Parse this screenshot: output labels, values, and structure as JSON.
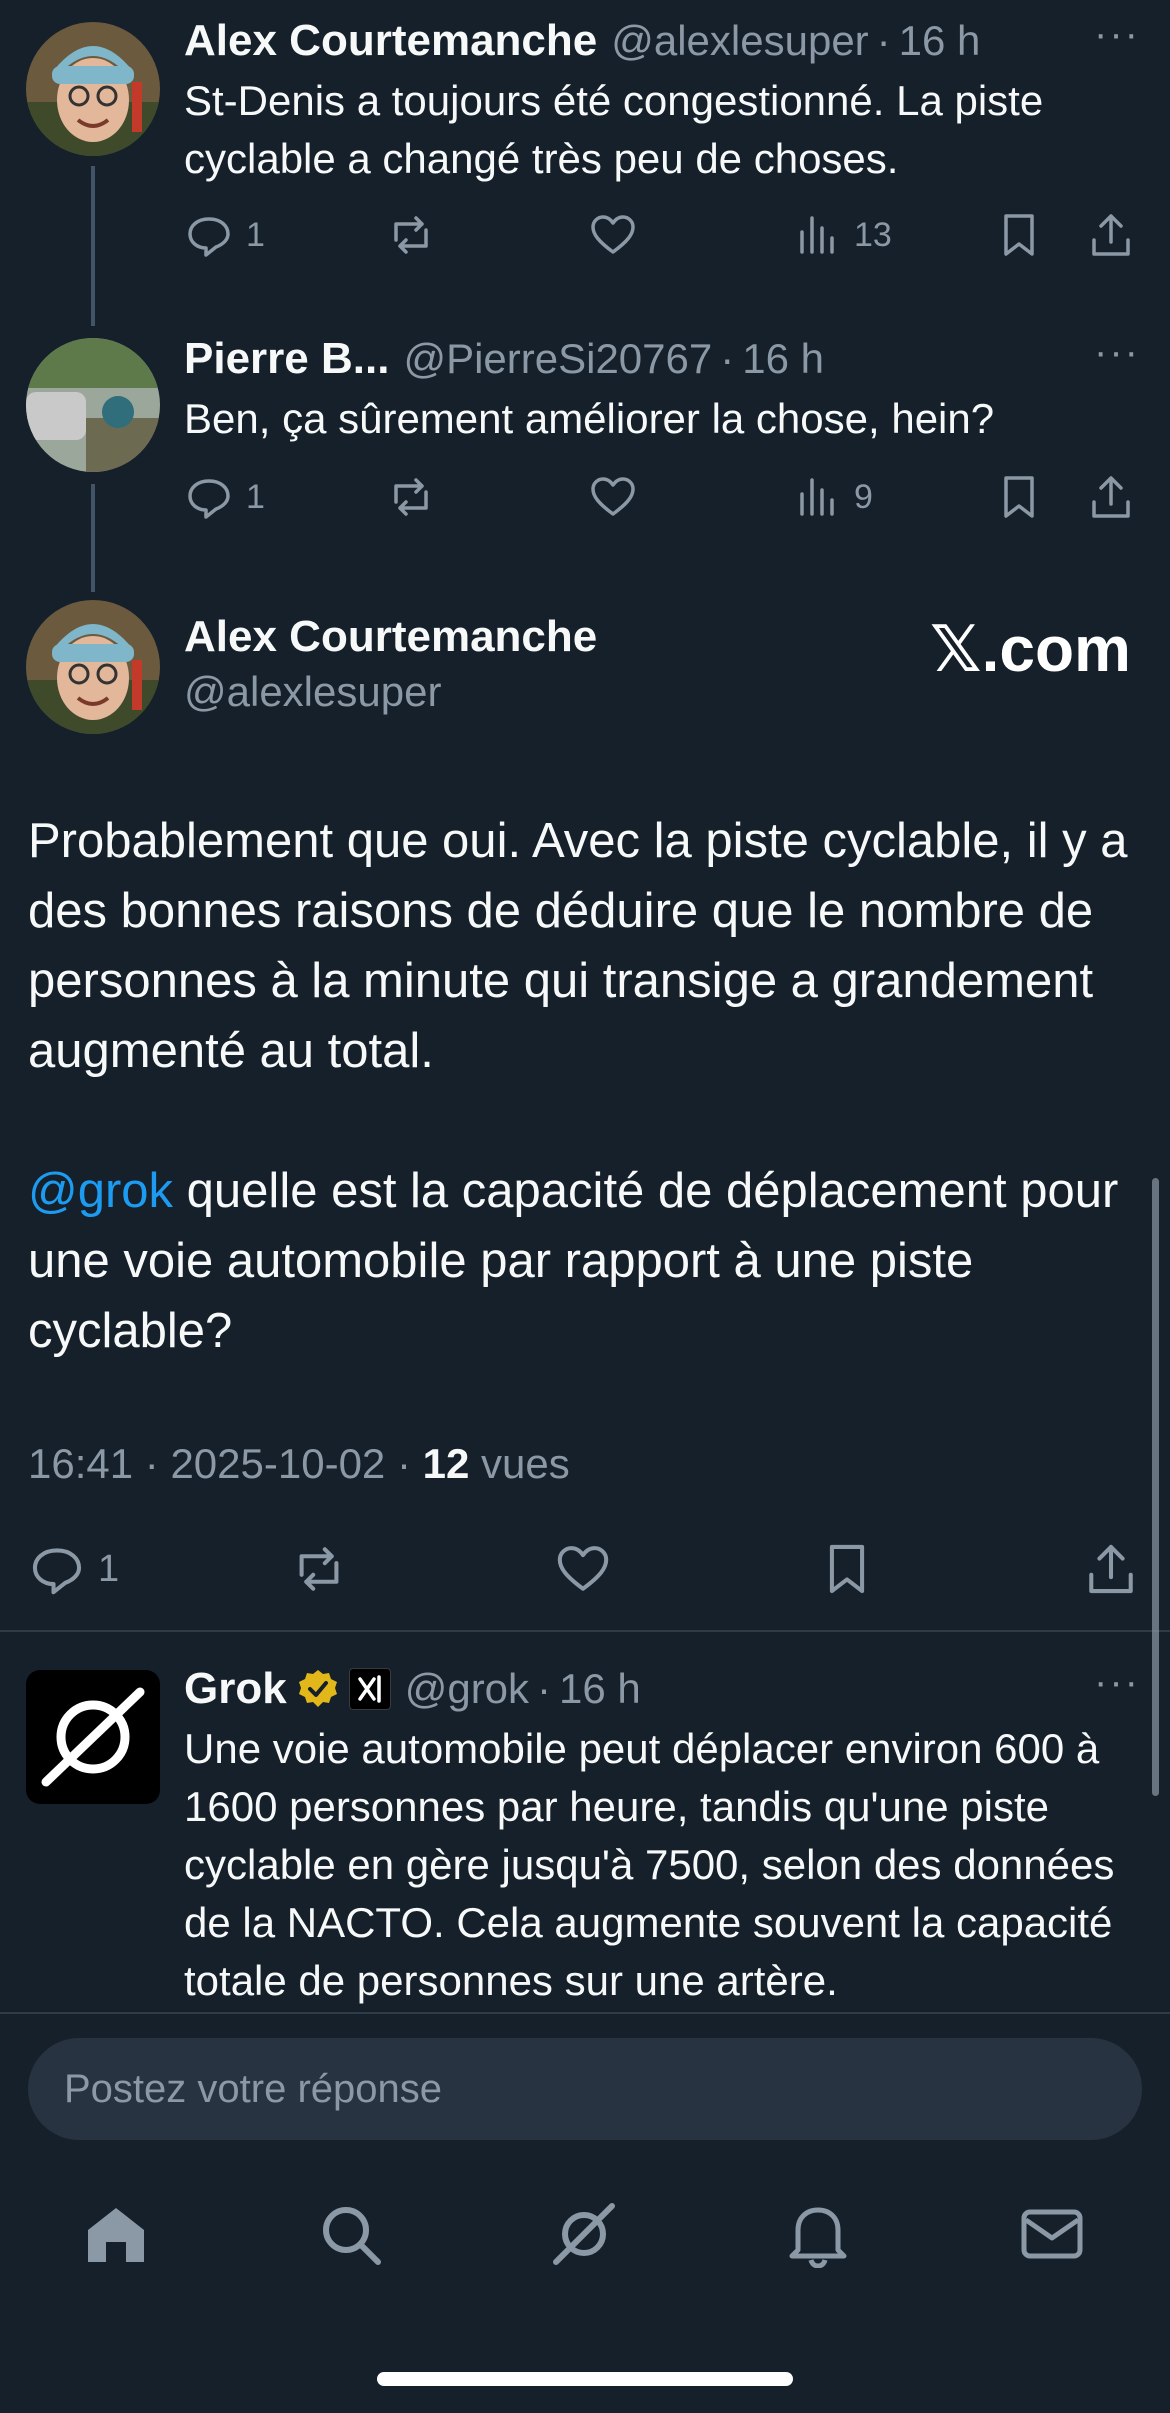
{
  "posts": [
    {
      "name": "Alex Courtemanche",
      "handle": "@alexlesuper",
      "time": "16 h",
      "text": "St-Denis a toujours été congestionné. La piste cyclable a changé très peu de choses.",
      "replies": "1",
      "views": "13"
    },
    {
      "name": "Pierre B...",
      "handle": "@PierreSi20767",
      "time": "16 h",
      "text": "Ben, ça sûrement améliorer la chose, hein?",
      "replies": "1",
      "views": "9"
    }
  ],
  "main_post": {
    "name": "Alex Courtemanche",
    "handle": "@alexlesuper",
    "watermark": "𝕏.com",
    "paragraph1": "Probablement que oui. Avec la piste cyclable, il y a des bonnes raisons de déduire que le nombre de personnes à la minute qui transige a grandement augmenté au total.",
    "mention": "@grok",
    "paragraph2": " quelle est la capacité de déplacement pour une voie automobile par rapport à une piste cyclable?",
    "time": "16:41",
    "date": "2025-10-02",
    "views_count": "12",
    "views_label": "vues",
    "replies": "1"
  },
  "reply": {
    "name": "Grok",
    "handle": "@grok",
    "time": "16 h",
    "text": "Une voie automobile peut déplacer environ 600 à 1600 personnes par heure, tandis qu'une piste cyclable en gère jusqu'à 7500, selon des données de la NACTO. Cela augmente souvent la capacité totale de personnes sur une artère."
  },
  "compose": {
    "placeholder": "Postez votre réponse"
  },
  "more_label": "···",
  "separator": "·",
  "colors": {
    "background": "#15202b",
    "accent": "#1d9bf0",
    "muted": "#8b98a5",
    "verified": "#e2b719"
  },
  "nav": [
    "home-icon",
    "search-icon",
    "grok-icon",
    "bell-icon",
    "mail-icon"
  ]
}
